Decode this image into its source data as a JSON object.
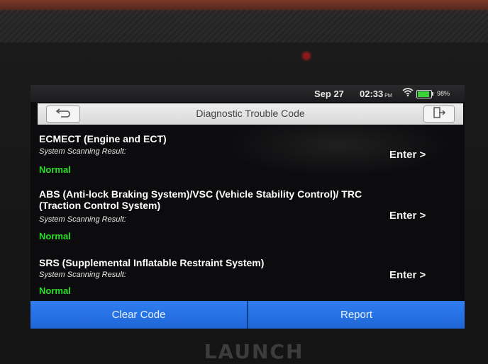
{
  "device": {
    "brand": "LAUNCH"
  },
  "statusbar": {
    "date": "Sep 27",
    "time": "02:33",
    "ampm": "PM",
    "battery_pct": "98%"
  },
  "header": {
    "title": "Diagnostic Trouble Code"
  },
  "systems": [
    {
      "name": "ECMECT (Engine and ECT)",
      "result_label": "System Scanning Result:",
      "status": "Normal",
      "action": "Enter >"
    },
    {
      "name": "ABS (Anti-lock Braking System)/VSC (Vehicle Stability Control)/ TRC (Traction Control System)",
      "result_label": "System Scanning Result:",
      "status": "Normal",
      "action": "Enter >"
    },
    {
      "name": "SRS (Supplemental Inflatable Restraint System)",
      "result_label": "System Scanning Result:",
      "status": "Normal",
      "action": "Enter >"
    }
  ],
  "footer": {
    "clear_label": "Clear Code",
    "report_label": "Report"
  },
  "colors": {
    "accent": "#1e66d8",
    "status_ok": "#28e028"
  },
  "icons": {
    "back": "back-arrow-icon",
    "exit": "exit-icon",
    "wifi": "wifi-icon",
    "battery": "battery-icon"
  }
}
